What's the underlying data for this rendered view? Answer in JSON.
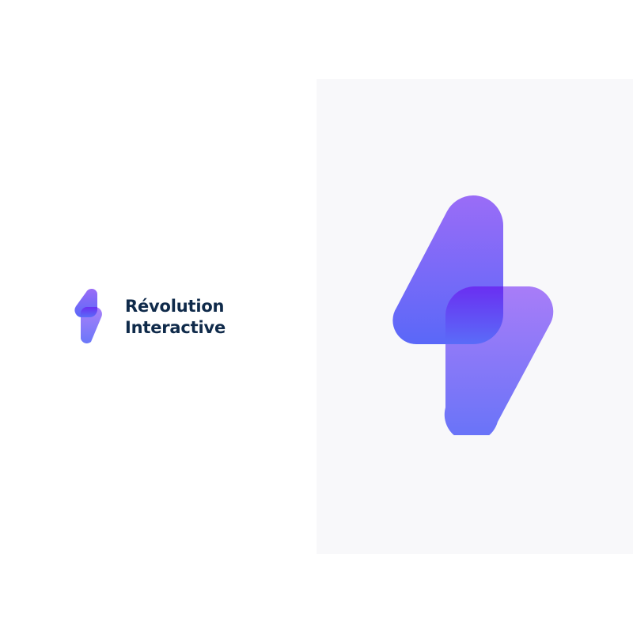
{
  "brand": {
    "name_line_1": "Révolution",
    "name_line_2": "Interactive",
    "text_color": "#0f2a4a"
  },
  "colors": {
    "page_background": "#ffffff",
    "left_panel_background": "#ffffff",
    "right_panel_background": "#f8f8fa",
    "gradient_top": "#9a6cf7",
    "gradient_bottom": "#5a68f8",
    "overlap_color": "#6c34f2"
  },
  "icons": {
    "small_mark": "lightning-bolt-logo-icon",
    "large_mark": "lightning-bolt-logo-icon"
  }
}
